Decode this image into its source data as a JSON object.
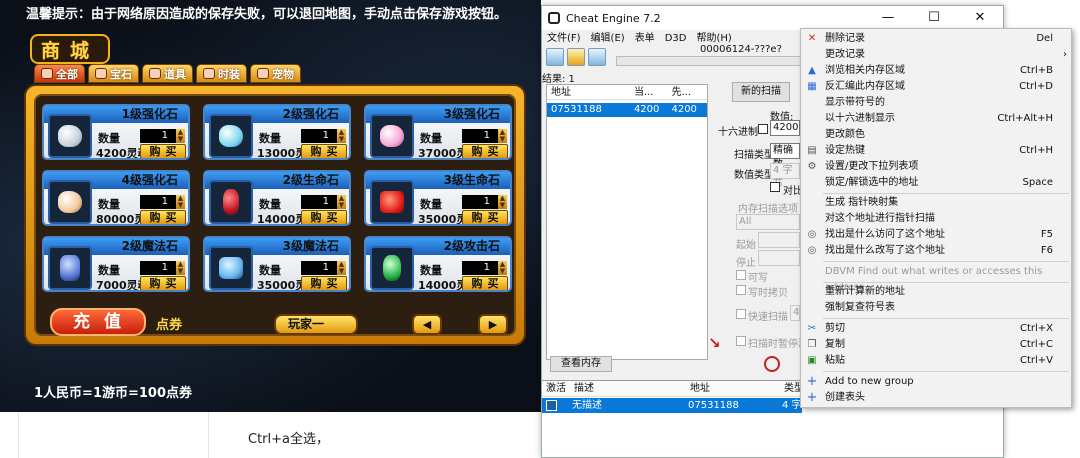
{
  "game": {
    "notice": "温馨提示：由于网络原因造成的保存失败，可以退回地图，手动点击保存游戏按钮。",
    "title": "商城",
    "tabs": [
      "全部",
      "宝石",
      "道具",
      "时装",
      "宠物"
    ],
    "items": [
      {
        "name": "1级强化石",
        "qty_label": "数量",
        "qty": "1",
        "price": "4200灵魂",
        "buy": "购买",
        "gem": "#c9d2dc"
      },
      {
        "name": "2级强化石",
        "qty_label": "数量",
        "qty": "1",
        "price": "13000灵",
        "buy": "购买",
        "gem": "#7fd8f0"
      },
      {
        "name": "3级强化石",
        "qty_label": "数量",
        "qty": "1",
        "price": "37000灵",
        "buy": "购买",
        "gem": "#f5a9d6"
      },
      {
        "name": "4级强化石",
        "qty_label": "数量",
        "qty": "1",
        "price": "80000灵",
        "buy": "购买",
        "gem": "#f4c8a0"
      },
      {
        "name": "2级生命石",
        "qty_label": "数量",
        "qty": "1",
        "price": "14000灵",
        "buy": "购买",
        "gem": "#c8182a"
      },
      {
        "name": "3级生命石",
        "qty_label": "数量",
        "qty": "1",
        "price": "35000灵",
        "buy": "购买",
        "gem": "#e8201e"
      },
      {
        "name": "2级魔法石",
        "qty_label": "数量",
        "qty": "1",
        "price": "7000灵魂",
        "buy": "购买",
        "gem": "#5a7ad8"
      },
      {
        "name": "3级魔法石",
        "qty_label": "数量",
        "qty": "1",
        "price": "35000灵",
        "buy": "购买",
        "gem": "#6ab8f0"
      },
      {
        "name": "2级攻击石",
        "qty_label": "数量",
        "qty": "1",
        "price": "14000灵",
        "buy": "购买",
        "gem": "#2cb84a"
      }
    ],
    "recharge": "充值",
    "points": "点券",
    "player": "玩家一",
    "rate": "1人民币=1游币=100点券"
  },
  "doc": {
    "text": "Ctrl+a全选，"
  },
  "ce": {
    "title": "Cheat Engine 7.2",
    "win_min": "—",
    "win_max": "☐",
    "win_close": "✕",
    "menu": [
      "文件(F)",
      "编辑(E)",
      "表单",
      "D3D",
      "帮助(H)"
    ],
    "process": "00006124-???e?",
    "found": "结果: 1",
    "result_headers": [
      "地址",
      "当...",
      "先..."
    ],
    "result_row": [
      "07531188",
      "4200",
      "4200"
    ],
    "new_scan": "新的扫描",
    "value_label": "数值:",
    "hex_label": "十六进制",
    "value": "4200",
    "scan_type_label": "扫描类型",
    "scan_type": "精确数",
    "value_type_label": "数值类型",
    "value_type": "4 字节",
    "compare_label": "对比",
    "mem_options": "内存扫描选项",
    "mem_all": "All",
    "start_label": "起始",
    "stop_label": "停止",
    "writable": "可写",
    "copy_on_write": "写时拷贝",
    "fast_scan": "快速扫描",
    "fast_val": "4",
    "pause_scan": "扫描时暂停游",
    "view_memory": "查看内存",
    "table_headers": [
      "激活",
      "描述",
      "地址",
      "类型"
    ],
    "table_row": [
      "无描述",
      "07531188",
      "4 字"
    ]
  },
  "context_menu": [
    {
      "label": "删除记录",
      "shortcut": "Del",
      "icon": "delete-icon",
      "glyph": "✕",
      "color": "#d02020"
    },
    {
      "label": "更改记录",
      "shortcut": "›",
      "icon": "",
      "glyph": "",
      "color": ""
    },
    {
      "label": "浏览相关内存区域",
      "shortcut": "Ctrl+B",
      "icon": "memory-icon",
      "glyph": "▲",
      "color": "#2a6ad8"
    },
    {
      "label": "反汇编此内存区域",
      "shortcut": "Ctrl+D",
      "icon": "disassemble-icon",
      "glyph": "▦",
      "color": "#2a6ad8"
    },
    {
      "label": "显示带符号的",
      "shortcut": "",
      "icon": "",
      "glyph": "",
      "color": ""
    },
    {
      "label": "以十六进制显示",
      "shortcut": "Ctrl+Alt+H",
      "icon": "",
      "glyph": "",
      "color": ""
    },
    {
      "label": "更改颜色",
      "shortcut": "",
      "icon": "",
      "glyph": "",
      "color": ""
    },
    {
      "label": "设定热键",
      "shortcut": "Ctrl+H",
      "icon": "hotkey-icon",
      "glyph": "▤",
      "color": "#555"
    },
    {
      "label": "设置/更改下拉列表项",
      "shortcut": "",
      "icon": "gear-icon",
      "glyph": "⚙",
      "color": "#555"
    },
    {
      "label": "锁定/解锁选中的地址",
      "shortcut": "Space",
      "icon": "",
      "glyph": "",
      "color": ""
    },
    {
      "label": "生成 指针映射集",
      "shortcut": "",
      "icon": "",
      "glyph": "",
      "color": ""
    },
    {
      "label": "对这个地址进行指针扫描",
      "shortcut": "",
      "icon": "",
      "glyph": "",
      "color": ""
    },
    {
      "label": "找出是什么访问了这个地址",
      "shortcut": "F5",
      "icon": "find-access-icon",
      "glyph": "◎",
      "color": "#555"
    },
    {
      "label": "找出是什么改写了这个地址",
      "shortcut": "F6",
      "icon": "find-write-icon",
      "glyph": "◎",
      "color": "#555"
    },
    {
      "label": "DBVM Find out what writes or accesses this address",
      "shortcut": "",
      "icon": "",
      "glyph": "",
      "color": "",
      "disabled": true
    },
    {
      "label": "重新计算新的地址",
      "shortcut": "",
      "icon": "",
      "glyph": "",
      "color": ""
    },
    {
      "label": "强制复查符号表",
      "shortcut": "",
      "icon": "",
      "glyph": "",
      "color": ""
    },
    {
      "label": "剪切",
      "shortcut": "Ctrl+X",
      "icon": "cut-icon",
      "glyph": "✂",
      "color": "#2a6ad8"
    },
    {
      "label": "复制",
      "shortcut": "Ctrl+C",
      "icon": "copy-icon",
      "glyph": "❐",
      "color": "#555"
    },
    {
      "label": "粘贴",
      "shortcut": "Ctrl+V",
      "icon": "paste-icon",
      "glyph": "▣",
      "color": "#2a8a2a"
    },
    {
      "label": "Add to new group",
      "shortcut": "",
      "icon": "plus-icon",
      "glyph": "+",
      "color": "#2a6ad8"
    },
    {
      "label": "创建表头",
      "shortcut": "",
      "icon": "plus-icon",
      "glyph": "+",
      "color": "#2a6ad8"
    }
  ]
}
